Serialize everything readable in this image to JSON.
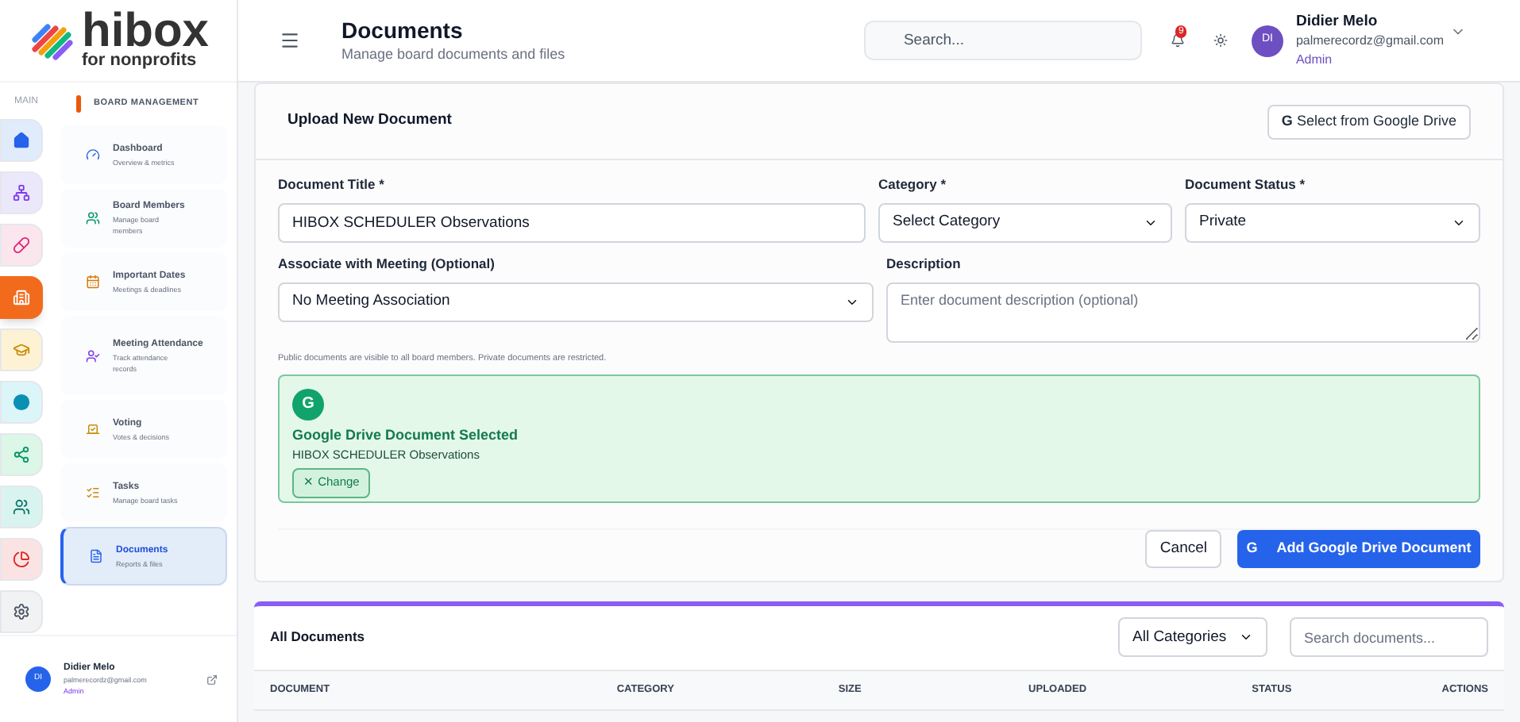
{
  "logo": {
    "name": "hibox",
    "tagline": "for nonprofits"
  },
  "rail": {
    "label": "MAIN",
    "items": [
      {
        "color": "#e0ecfb",
        "selected": false
      },
      {
        "color": "#ece8fb",
        "selected": false
      },
      {
        "color": "#fbe6ee",
        "selected": false
      },
      {
        "color": "#f26b1d",
        "selected": true
      },
      {
        "color": "#fdf3d4",
        "selected": false
      },
      {
        "color": "#dcf5f8",
        "selected": false
      },
      {
        "color": "#dcf6e8",
        "selected": false
      },
      {
        "color": "#d9f4ef",
        "selected": false
      },
      {
        "color": "#fbe3e3",
        "selected": false
      },
      {
        "color": "#f1f2f4",
        "selected": false
      }
    ]
  },
  "submenu": {
    "heading": "BOARD MANAGEMENT",
    "items": [
      {
        "title": "Dashboard",
        "subtitle": "Overview & metrics",
        "selected": false
      },
      {
        "title": "Board Members",
        "subtitle": "Manage board members",
        "selected": false
      },
      {
        "title": "Important Dates",
        "subtitle": "Meetings & deadlines",
        "selected": false
      },
      {
        "title": "Meeting Attendance",
        "subtitle": "Track attendance records",
        "selected": false
      },
      {
        "title": "Voting",
        "subtitle": "Votes & decisions",
        "selected": false
      },
      {
        "title": "Tasks",
        "subtitle": "Manage board tasks",
        "selected": false
      },
      {
        "title": "Documents",
        "subtitle": "Reports & files",
        "selected": true
      }
    ]
  },
  "sidebar_user": {
    "initials": "DI",
    "name": "Didier Melo",
    "email": "palmerecordz@gmail.com",
    "role": "Admin"
  },
  "header": {
    "title": "Documents",
    "subtitle": "Manage board documents and files",
    "search_placeholder": "Search...",
    "notification_count": "9",
    "user": {
      "initials": "DI",
      "name": "Didier Melo",
      "email": "palmerecordz@gmail.com",
      "role": "Admin"
    }
  },
  "upload": {
    "title": "Upload New Document",
    "drive_button_icon": "G",
    "drive_button": "Select from Google Drive",
    "fields": {
      "title_label": "Document Title *",
      "title_value": "HIBOX SCHEDULER Observations",
      "category_label": "Category *",
      "category_value": "Select Category",
      "status_label": "Document Status *",
      "status_value": "Private",
      "meeting_label": "Associate with Meeting (Optional)",
      "meeting_value": "No Meeting Association",
      "description_label": "Description",
      "description_placeholder": "Enter document description (optional)"
    },
    "note": "Public documents are visible to all board members. Private documents are restricted.",
    "selected_drive": {
      "badge": "G",
      "title": "Google Drive Document Selected",
      "file": "HIBOX SCHEDULER Observations",
      "change": "✕ Change"
    },
    "cancel": "Cancel",
    "submit_icon": "G",
    "submit": "Add Google Drive Document"
  },
  "documents": {
    "title": "All Documents",
    "filter": "All Categories",
    "search_placeholder": "Search documents...",
    "columns": [
      "DOCUMENT",
      "CATEGORY",
      "SIZE",
      "UPLOADED",
      "STATUS",
      "ACTIONS"
    ]
  }
}
